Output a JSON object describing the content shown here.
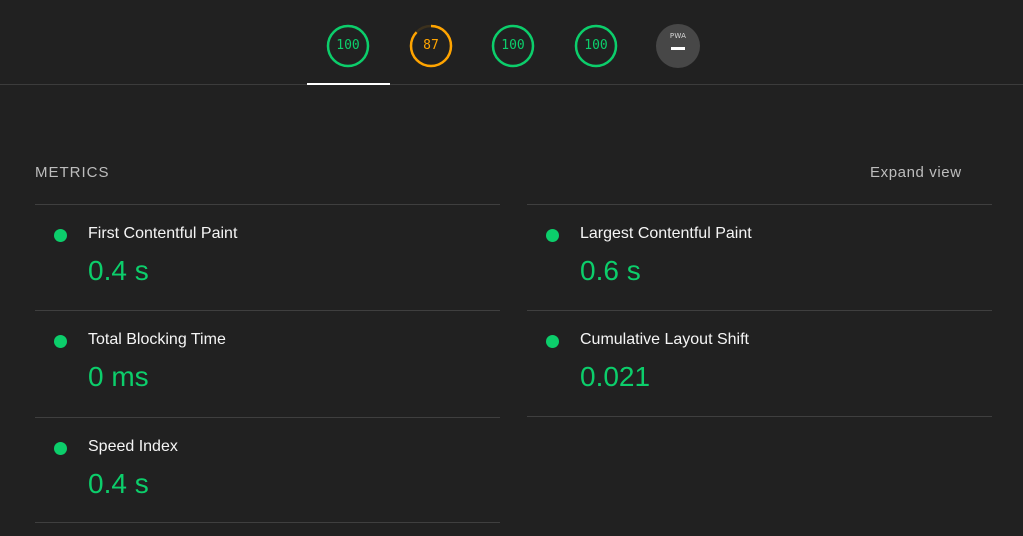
{
  "categories": [
    {
      "score": "100",
      "rating": "pass",
      "fraction": 1.0,
      "color": "#0cce6b"
    },
    {
      "score": "87",
      "rating": "average",
      "fraction": 0.87,
      "color": "#ffa400"
    },
    {
      "score": "100",
      "rating": "pass",
      "fraction": 1.0,
      "color": "#0cce6b"
    },
    {
      "score": "100",
      "rating": "pass",
      "fraction": 1.0,
      "color": "#0cce6b"
    }
  ],
  "pwa": {
    "label": "PWA",
    "icon": "dash-icon"
  },
  "metrics_section": {
    "title": "METRICS",
    "expand_label": "Expand view"
  },
  "metrics": [
    {
      "label": "First Contentful Paint",
      "value": "0.4 s",
      "status": "pass"
    },
    {
      "label": "Largest Contentful Paint",
      "value": "0.6 s",
      "status": "pass"
    },
    {
      "label": "Total Blocking Time",
      "value": "0 ms",
      "status": "pass"
    },
    {
      "label": "Cumulative Layout Shift",
      "value": "0.021",
      "status": "pass"
    },
    {
      "label": "Speed Index",
      "value": "0.4 s",
      "status": "pass"
    }
  ],
  "colors": {
    "pass": "#0cce6b",
    "average": "#ffa400",
    "background": "#212121"
  }
}
